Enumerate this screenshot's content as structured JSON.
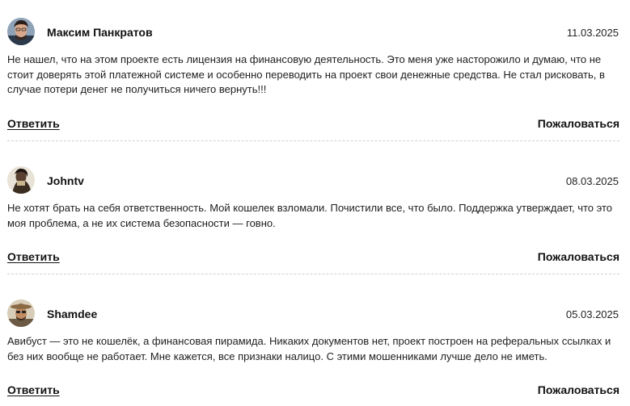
{
  "reviews": [
    {
      "author": "Максим Панкратов",
      "date": "11.03.2025",
      "avatar_icon": "user-photo-avatar-icon",
      "text": "Не нашел, что на этом проекте есть лицензия на финансовую деятельность. Это меня уже насторожило и думаю, что не стоит доверять этой платежной системе и особенно переводить на проект свои денежные средства. Не стал рисковать, в случае потери денег не получиться ничего вернуть!!!",
      "reply_label": "Ответить",
      "complain_label": "Пожаловаться"
    },
    {
      "author": "Johntv",
      "date": "08.03.2025",
      "avatar_icon": "user-photo-avatar-icon",
      "text": "Не хотят брать на себя ответственность. Мой кошелек взломали. Почистили все, что было. Поддержка утверждает, что это моя проблема, а не их система безопасности — говно.",
      "reply_label": "Ответить",
      "complain_label": "Пожаловаться"
    },
    {
      "author": "Shamdee",
      "date": "05.03.2025",
      "avatar_icon": "user-photo-avatar-icon",
      "text": "Авибуст — это не кошелёк, а финансовая пирамида. Никаких документов нет, проект построен на реферальных ссылках и без них вообще не работает. Мне кажется, все признаки налицо. С этими мошенниками лучше дело не иметь.",
      "reply_label": "Ответить",
      "complain_label": "Пожаловаться"
    }
  ]
}
